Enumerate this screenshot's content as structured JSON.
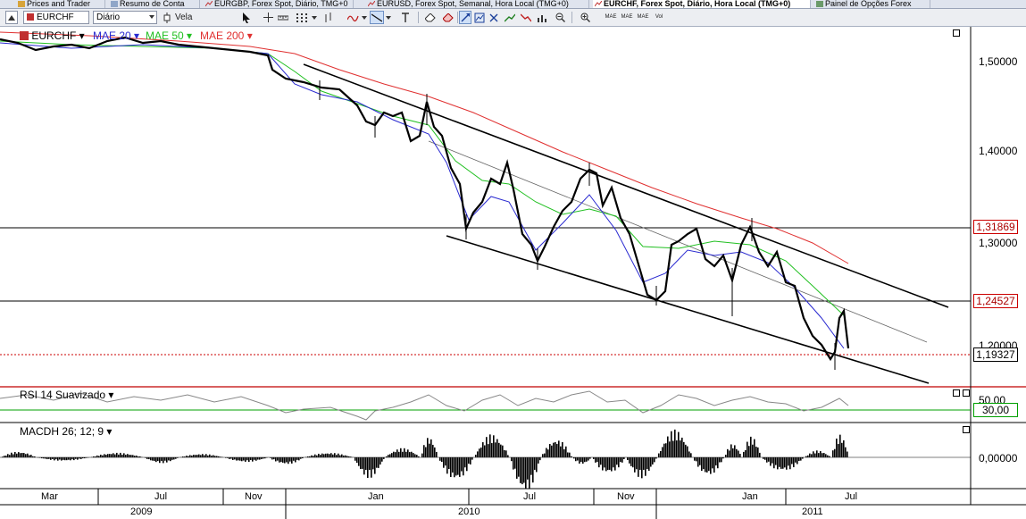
{
  "tabs": [
    {
      "label": "Prices and Trader",
      "icon": "prices-icon"
    },
    {
      "label": "Resumo de Conta",
      "icon": "account-icon"
    },
    {
      "label": "EURGBP, Forex Spot, Diário, TMG+0",
      "icon": "chart-tab-icon"
    },
    {
      "label": "EURUSD, Forex Spot, Semanal, Hora Local (TMG+0)",
      "icon": "chart-tab-icon"
    },
    {
      "label": "EURCHF, Forex Spot, Diário, Hora Local (TMG+0)",
      "icon": "chart-tab-icon",
      "active": true
    },
    {
      "label": "Painel de Opções Forex",
      "icon": "options-icon"
    }
  ],
  "toolbar": {
    "symbol": "EURCHF",
    "interval": "Diário",
    "chart_style": "Vela",
    "mini_labels": [
      "MAE",
      "MAE",
      "MAE",
      "Vol"
    ]
  },
  "legend": {
    "symbol": "EURCHF",
    "ma20": "MAE 20",
    "ma50": "MAE 50",
    "ma200": "MAE 200"
  },
  "colors": {
    "ma20": "#2a2ad0",
    "ma50": "#22c022",
    "ma200": "#e03030",
    "current_price": "#cc0000",
    "rsi_level": "#00a000"
  },
  "price_axis": {
    "ticks": [
      "1,50000",
      "1,40000",
      "1,30000",
      "1,20000"
    ],
    "markers": [
      "1,31869",
      "1,24527",
      "1,19327"
    ]
  },
  "rsi": {
    "label": "RSI 14 Suavizado",
    "ticks": [
      "50,00"
    ],
    "level": "30,00"
  },
  "macd": {
    "label": "MACDH 26; 12; 9",
    "ticks": [
      "0,00000"
    ]
  },
  "time_axis": {
    "months": [
      "Mar",
      "Jul",
      "Nov",
      "Jan",
      "Jul",
      "Nov",
      "Jan",
      "Jul"
    ],
    "years": [
      "2009",
      "2010",
      "2011"
    ]
  }
}
